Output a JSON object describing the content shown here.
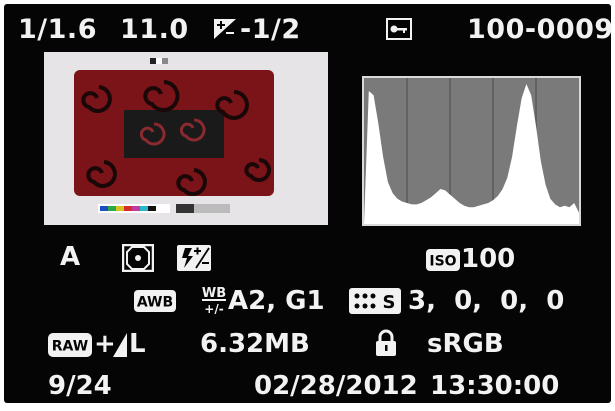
{
  "top": {
    "shutter": "1/1.6",
    "aperture": "11.0",
    "exposure_comp": "-1/2",
    "exposure_comp_icon": "exposure-compensation-icon",
    "protect_icon": "key-protect-icon",
    "file_number": "100-0009"
  },
  "settings": {
    "mode": "A",
    "metering_icon": "evaluative-metering-icon",
    "flash_comp_icon": "flash-compensation-icon",
    "iso_label": "ISO",
    "iso_value": "100",
    "awb_label": "AWB",
    "wb_shift_label": "WB +/-",
    "wb_shift_value": "A2, G1",
    "picture_style_label": "S",
    "picture_style_values": "3,  0,  0,  0",
    "raw_label": "RAW",
    "quality": "L",
    "file_size": "6.32MB",
    "lock_icon": "lock-icon",
    "color_space": "sRGB",
    "frame": "9/24",
    "date": "02/28/2012",
    "time": "13:30:00"
  },
  "histogram": {
    "levels": [
      0,
      95,
      92,
      72,
      48,
      30,
      22,
      18,
      16,
      15,
      14,
      14,
      15,
      17,
      19,
      22,
      25,
      24,
      21,
      18,
      15,
      13,
      12,
      12,
      13,
      14,
      15,
      17,
      20,
      25,
      33,
      48,
      70,
      90,
      100,
      92,
      70,
      45,
      28,
      18,
      14,
      12,
      13,
      12,
      15,
      8
    ]
  },
  "colors": {
    "background": "#050505",
    "text": "#f2f2f2",
    "thumbnail_fabric": "#7a1418",
    "histogram_bg": "#7a7a7a"
  }
}
